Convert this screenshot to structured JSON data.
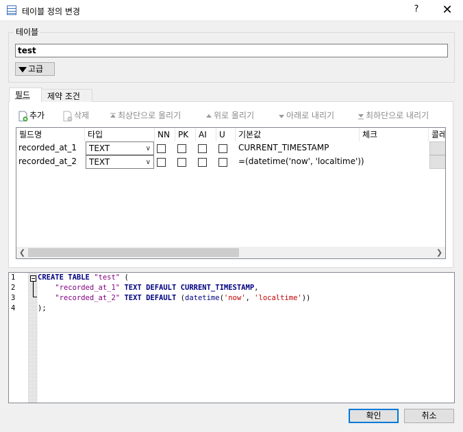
{
  "window": {
    "title": "테이블 정의 변경",
    "help_label": "?",
    "close_label": "✕"
  },
  "table_group": {
    "label": "테이블",
    "name_value": "test",
    "advanced_label": "고급"
  },
  "tabs": [
    {
      "label": "필드"
    },
    {
      "label": "제약 조건"
    }
  ],
  "toolbar": {
    "add": "추가",
    "delete": "삭제",
    "move_top": "최상단으로 올리기",
    "move_up": "위로 올리기",
    "move_down": "아래로 내리기",
    "move_bottom": "최하단으로 내리기"
  },
  "grid": {
    "headers": [
      "필드명",
      "타입",
      "NN",
      "PK",
      "AI",
      "U",
      "기본값",
      "체크",
      "콜레"
    ],
    "rows": [
      {
        "name": "recorded_at_1",
        "type": "TEXT",
        "nn": false,
        "pk": false,
        "ai": false,
        "u": false,
        "default": "CURRENT_TIMESTAMP",
        "check": ""
      },
      {
        "name": "recorded_at_2",
        "type": "TEXT",
        "nn": false,
        "pk": false,
        "ai": false,
        "u": false,
        "default": "=(datetime('now', 'localtime'))",
        "check": ""
      }
    ]
  },
  "sql": {
    "line_numbers": [
      "1",
      "2",
      "3",
      "4"
    ],
    "lines": [
      "CREATE TABLE \"test\" (",
      "    \"recorded_at_1\" TEXT DEFAULT CURRENT_TIMESTAMP,",
      "    \"recorded_at_2\" TEXT DEFAULT (datetime('now', 'localtime'))",
      ");"
    ]
  },
  "buttons": {
    "ok": "확인",
    "cancel": "취소"
  },
  "colors": {
    "accent": "#0078d7",
    "keyword": "#000080",
    "string": "#800080",
    "literal": "#c00000"
  }
}
